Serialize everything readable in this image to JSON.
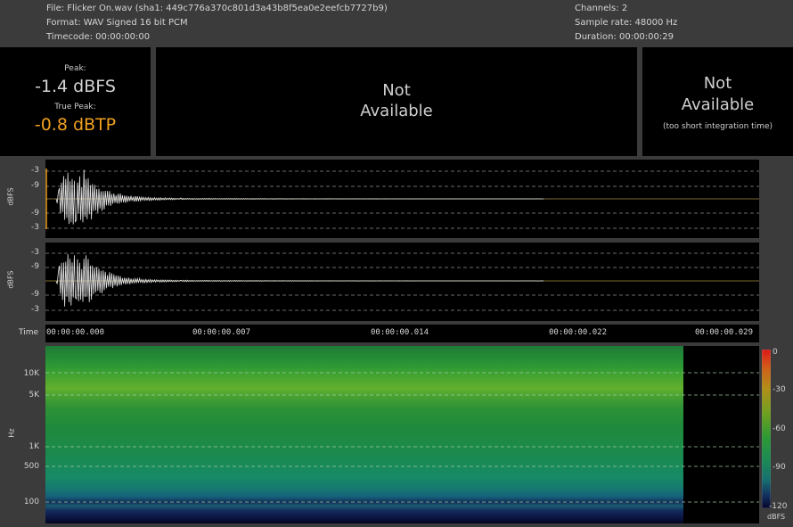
{
  "info": {
    "file": "File: Flicker On.wav (sha1: 449c776a370c801d3a43b8f5ea0e2eefcb7727b9)",
    "format": "Format: WAV Signed 16 bit PCM",
    "timecode": "Timecode:  00:00:00:00",
    "channels": "Channels: 2",
    "sample_rate": "Sample rate: 48000 Hz",
    "duration": "Duration:  00:00:00:29"
  },
  "peak": {
    "peak_label": "Peak:",
    "peak_value": "-1.4 dBFS",
    "true_peak_label": "True Peak:",
    "true_peak_value": "-0.8 dBTP",
    "true_peak_color": "#f0a020"
  },
  "loudness": {
    "line1": "Not",
    "line2": "Available"
  },
  "range": {
    "line1": "Not",
    "line2": "Available",
    "note": "(too short integration time)"
  },
  "waveform": {
    "ylabel": "dBFS",
    "ticks": [
      "-3",
      "-9",
      "-9",
      "-3"
    ],
    "time_label": "Time",
    "time_ticks": [
      "00:00:00.000",
      "00:00:00.007",
      "00:00:00.014",
      "00:00:00.022",
      "00:00:00.029"
    ]
  },
  "spectrogram": {
    "ylabel": "Hz",
    "ticks": [
      "10K",
      "5K",
      "1K",
      "500",
      "100"
    ],
    "scale_ticks": [
      "0",
      "-30",
      "-60",
      "-90",
      "-120"
    ],
    "scale_unit": "dBFS"
  }
}
